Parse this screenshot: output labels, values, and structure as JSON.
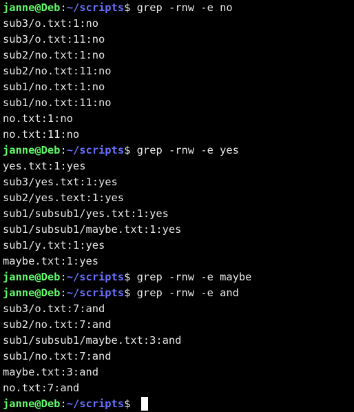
{
  "terminal": {
    "colors": {
      "background": "#000000",
      "foreground": "#e8e8e8",
      "prompt_user": "#5ff967",
      "prompt_path": "#6871ff",
      "cursor": "#ffffff"
    },
    "prompt": {
      "user_host": "janne@Deb",
      "colon": ":",
      "path": "~/scripts",
      "dollar": "$"
    },
    "lines": [
      {
        "type": "prompt",
        "command": "grep -rnw -e no"
      },
      {
        "type": "output",
        "text": "sub3/o.txt:1:no"
      },
      {
        "type": "output",
        "text": "sub3/o.txt:11:no"
      },
      {
        "type": "output",
        "text": "sub2/no.txt:1:no"
      },
      {
        "type": "output",
        "text": "sub2/no.txt:11:no"
      },
      {
        "type": "output",
        "text": "sub1/no.txt:1:no"
      },
      {
        "type": "output",
        "text": "sub1/no.txt:11:no"
      },
      {
        "type": "output",
        "text": "no.txt:1:no"
      },
      {
        "type": "output",
        "text": "no.txt:11:no"
      },
      {
        "type": "prompt",
        "command": "grep -rnw -e yes"
      },
      {
        "type": "output",
        "text": "yes.txt:1:yes"
      },
      {
        "type": "output",
        "text": "sub3/yes.txt:1:yes"
      },
      {
        "type": "output",
        "text": "sub2/yes.text:1:yes"
      },
      {
        "type": "output",
        "text": "sub1/subsub1/yes.txt:1:yes"
      },
      {
        "type": "output",
        "text": "sub1/subsub1/maybe.txt:1:yes"
      },
      {
        "type": "output",
        "text": "sub1/y.txt:1:yes"
      },
      {
        "type": "output",
        "text": "maybe.txt:1:yes"
      },
      {
        "type": "prompt",
        "command": "grep -rnw -e maybe"
      },
      {
        "type": "prompt",
        "command": "grep -rnw -e and"
      },
      {
        "type": "output",
        "text": "sub3/o.txt:7:and"
      },
      {
        "type": "output",
        "text": "sub2/no.txt:7:and"
      },
      {
        "type": "output",
        "text": "sub1/subsub1/maybe.txt:3:and"
      },
      {
        "type": "output",
        "text": "sub1/no.txt:7:and"
      },
      {
        "type": "output",
        "text": "maybe.txt:3:and"
      },
      {
        "type": "output",
        "text": "no.txt:7:and"
      },
      {
        "type": "prompt",
        "command": "",
        "cursor": true
      }
    ]
  }
}
